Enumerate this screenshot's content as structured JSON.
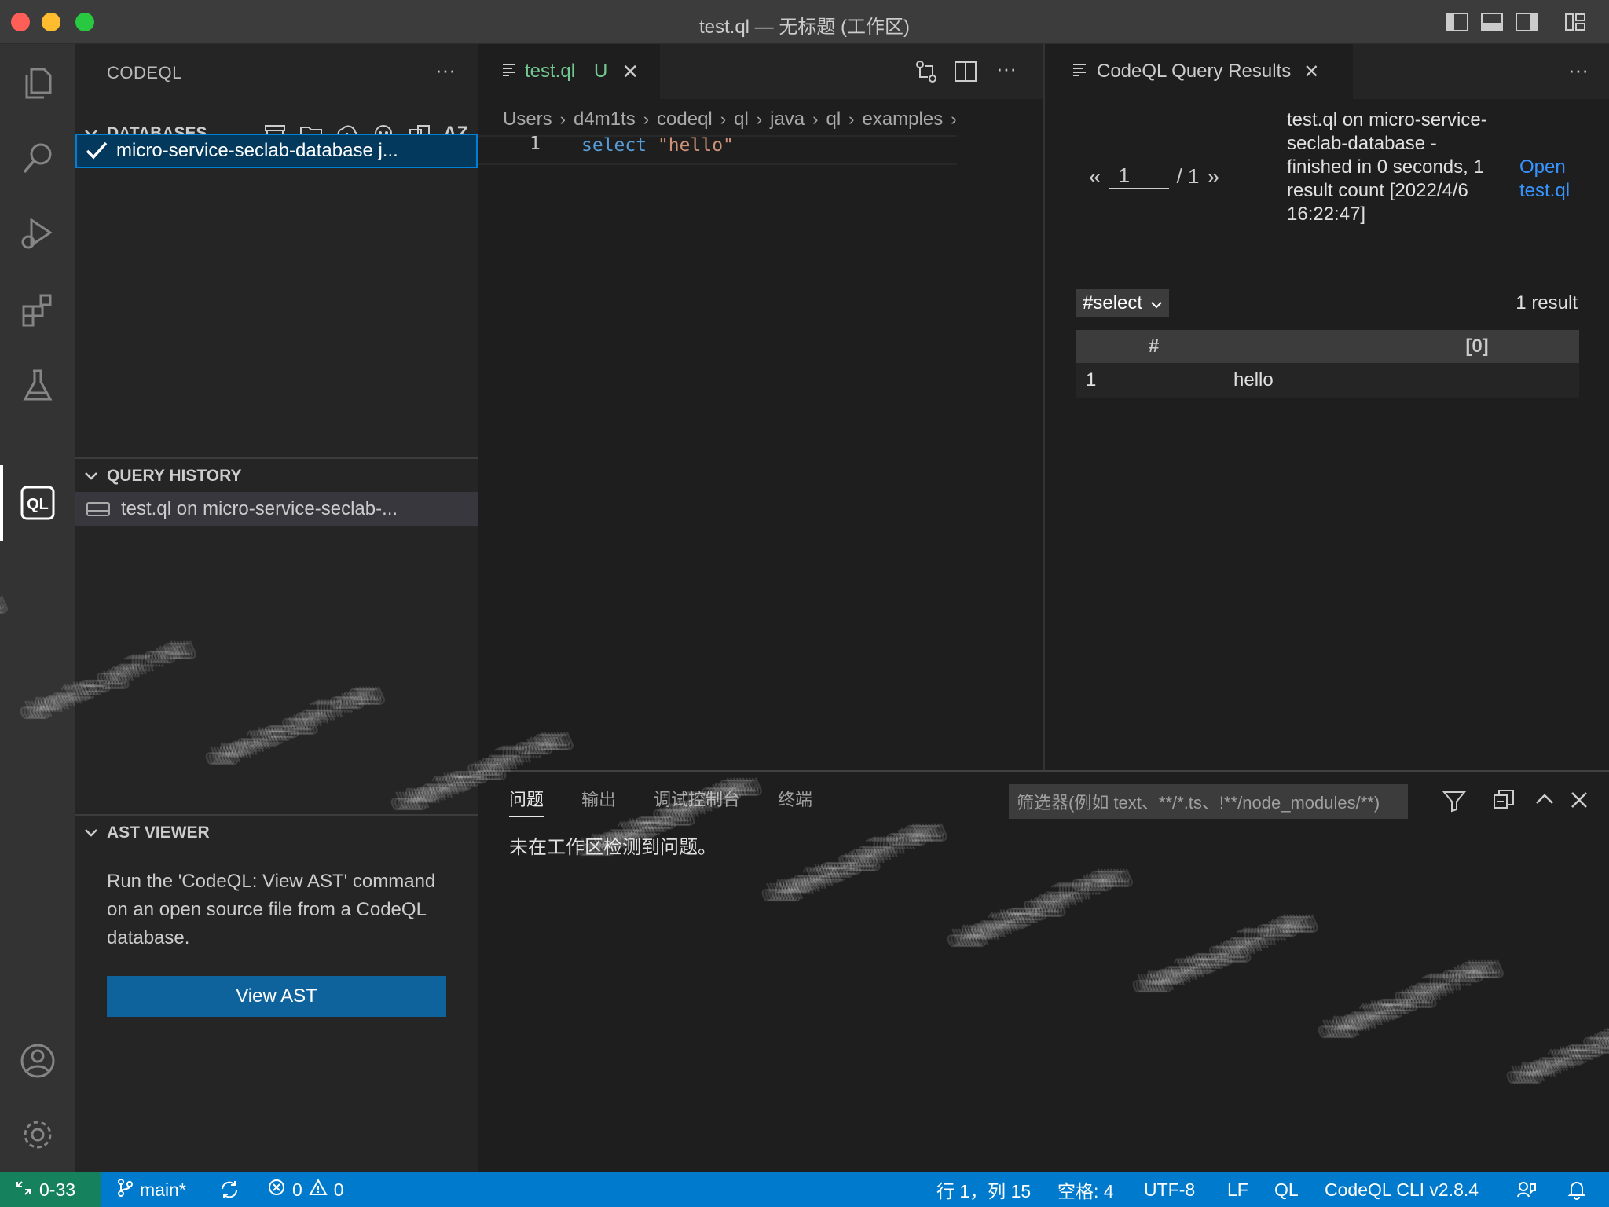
{
  "window": {
    "title": "test.ql — 无标题 (工作区)"
  },
  "activity_bar": {
    "items": [
      "explorer-icon",
      "search-icon",
      "run-debug-icon",
      "extensions-icon",
      "testing-icon",
      "codeql-icon"
    ],
    "bottom": [
      "accounts-icon",
      "settings-gear-icon"
    ],
    "codeql_label": "QL"
  },
  "sidebar": {
    "title": "CODEQL",
    "more": "···",
    "databases": {
      "header": "DATABASES",
      "sort_label": "AZ",
      "item_label": "micro-service-seclab-database  j..."
    },
    "query_history": {
      "header": "QUERY HISTORY",
      "item_label": "test.ql on micro-service-seclab-..."
    },
    "ast_viewer": {
      "header": "AST VIEWER",
      "text": "Run the 'CodeQL: View AST' command on an open source file from a CodeQL database.",
      "button_label": "View AST"
    }
  },
  "editor": {
    "tab": {
      "filename": "test.ql",
      "status": "U",
      "close": "✕"
    },
    "more": "···",
    "breadcrumb": [
      "Users",
      "d4m1ts",
      "codeql",
      "ql",
      "java",
      "ql",
      "examples"
    ],
    "line_number": "1",
    "code_keyword": "select",
    "code_string": "\"hello\""
  },
  "results_panel": {
    "tab_title": "CodeQL Query Results",
    "close": "✕",
    "more": "···",
    "pager": {
      "prev": "«",
      "current": "1",
      "total": "/ 1",
      "next": "»"
    },
    "summary": "test.ql on micro-service-seclab-database - finished in 0 seconds, 1 result count [2022/4/6 16:22:47]",
    "open_link": "Open test.ql",
    "result_set": "#select",
    "result_count": "1 result",
    "table": {
      "headers": [
        "#",
        "[0]"
      ],
      "rows": [
        [
          "1",
          "hello"
        ]
      ]
    }
  },
  "bottom_panel": {
    "tabs": [
      "问题",
      "输出",
      "调试控制台",
      "终端"
    ],
    "active_tab": "问题",
    "filter_placeholder": "筛选器(例如 text、**/*.ts、!**/node_modules/**)",
    "message": "未在工作区检测到问题。"
  },
  "status_bar": {
    "remote": "0-33",
    "branch": "main*",
    "errors": "0",
    "warnings": "0",
    "cursor": "行 1，列 15",
    "indent": "空格: 4",
    "encoding": "UTF-8",
    "eol": "LF",
    "language": "QL",
    "cli_version": "CodeQL CLI v2.8.4"
  },
  "watermark": {
    "text": "d4m1ts gm7.org"
  },
  "colors": {
    "status_bar": "#007acc",
    "remote_indicator": "#16825d",
    "selection": "#04395e",
    "button": "#0e639c",
    "untracked_file": "#73c991",
    "link": "#3794ff"
  }
}
